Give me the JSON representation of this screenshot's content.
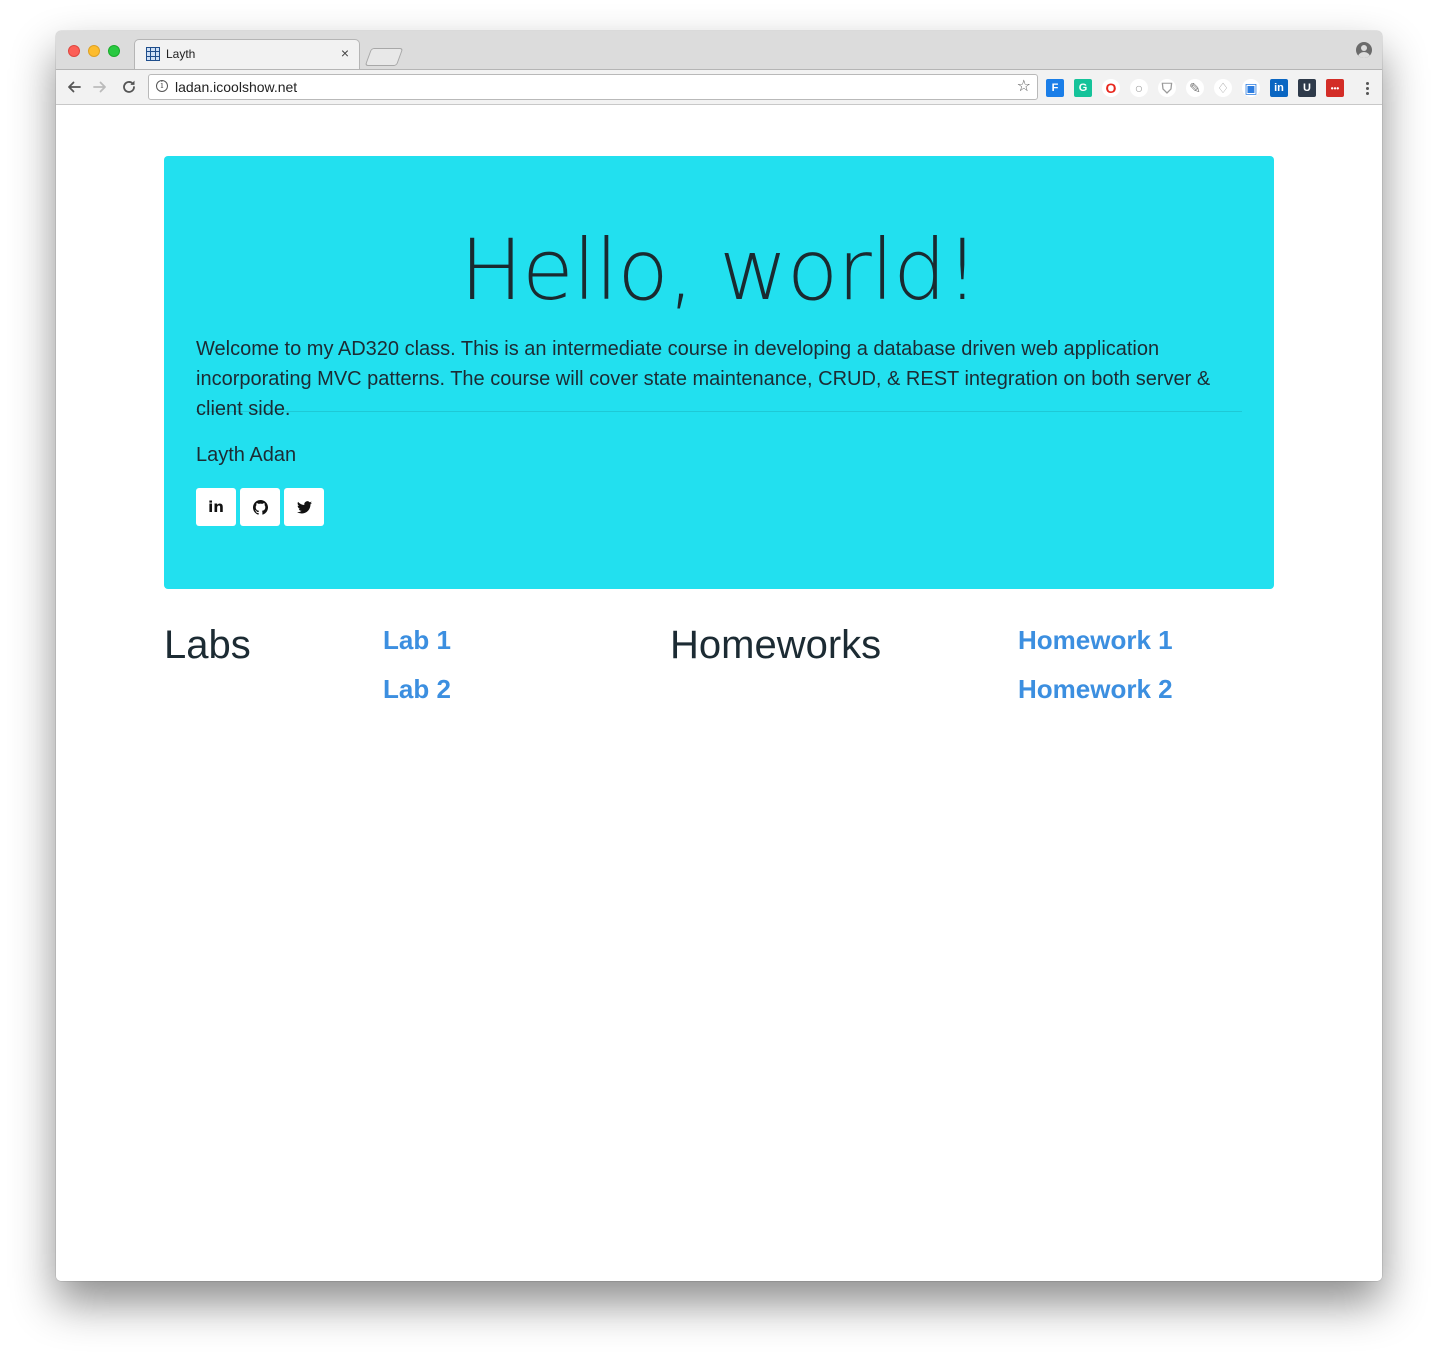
{
  "browser": {
    "tab_title": "Layth",
    "tab_close": "×",
    "url": "ladan.icoolshow.net",
    "extensions": [
      {
        "name": "f-extension-icon",
        "glyph": "F",
        "bg": "#1a7ee8",
        "color": "#ffffff"
      },
      {
        "name": "grammarly-icon",
        "glyph": "G",
        "bg": "#15c39a",
        "color": "#ffffff"
      },
      {
        "name": "opera-icon",
        "glyph": "O",
        "bg": "#ffffff",
        "color": "#e8261c"
      },
      {
        "name": "circle-extension-icon",
        "glyph": "○",
        "bg": "#ffffff",
        "color": "#9a9a9a"
      },
      {
        "name": "shield-extension-icon",
        "glyph": "⛉",
        "bg": "#ffffff",
        "color": "#9a9a9a"
      },
      {
        "name": "pen-extension-icon",
        "glyph": "✎",
        "bg": "#ffffff",
        "color": "#777777"
      },
      {
        "name": "gem-extension-icon",
        "glyph": "♢",
        "bg": "#ffffff",
        "color": "#9a9a9a"
      },
      {
        "name": "tag-extension-icon",
        "glyph": "▣",
        "bg": "#ffffff",
        "color": "#2d7de0"
      },
      {
        "name": "linkedin-extension-icon",
        "glyph": "in",
        "bg": "#0a66c2",
        "color": "#ffffff"
      },
      {
        "name": "pocket-extension-icon",
        "glyph": "U",
        "bg": "#2e3a4a",
        "color": "#ffffff"
      },
      {
        "name": "lastpass-extension-icon",
        "glyph": "•••",
        "bg": "#d32d27",
        "color": "#ffffff"
      }
    ]
  },
  "page": {
    "heading": "Hello, world!",
    "lead": "Welcome to my AD320 class. This is an intermediate course in developing a database driven web application incorporating MVC patterns. The course will cover state maintenance, CRUD, & REST integration on both server & client side.",
    "author": "Layth Adan",
    "social": {
      "linkedin": "in",
      "github": "github",
      "twitter": "twitter"
    },
    "labs": {
      "title": "Labs",
      "links": [
        "Lab 1",
        "Lab 2"
      ]
    },
    "homeworks": {
      "title": "Homeworks",
      "links": [
        "Homework 1",
        "Homework 2"
      ]
    }
  },
  "colors": {
    "jumbotron_bg": "#22e0ef",
    "link": "#3c8fe0",
    "text": "#1c2b33"
  }
}
